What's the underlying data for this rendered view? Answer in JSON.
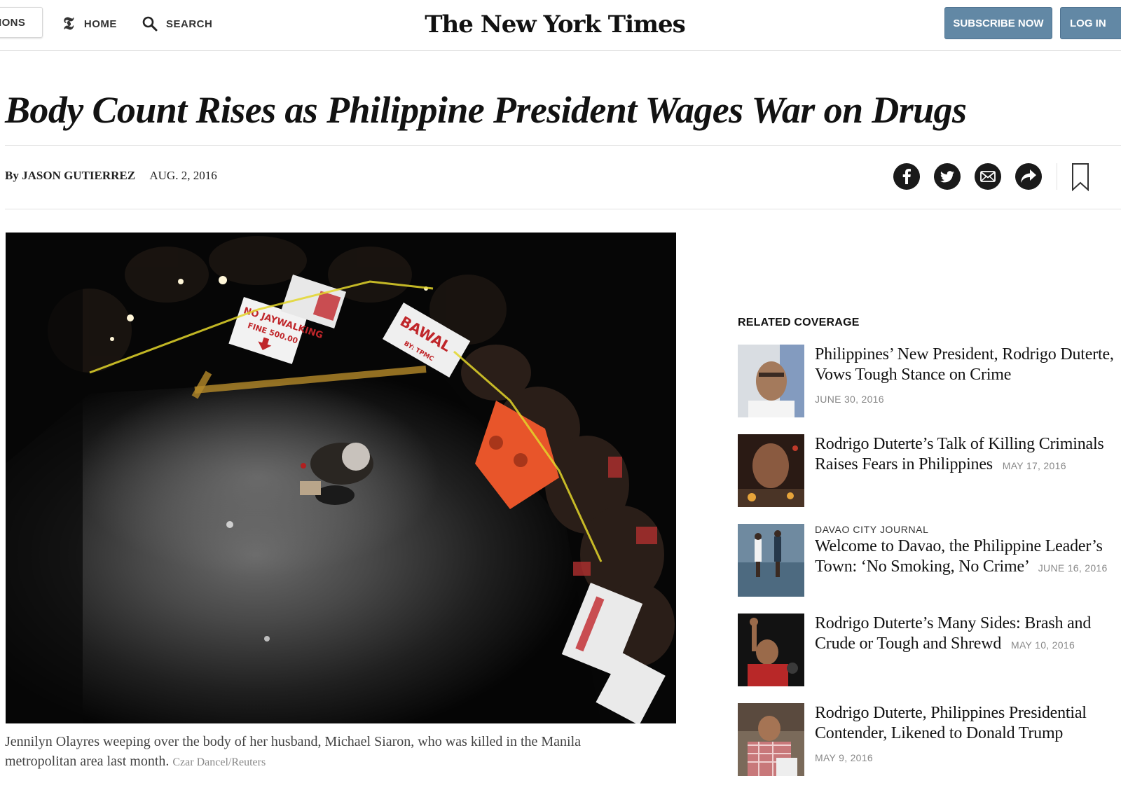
{
  "header": {
    "sections_label": "IONS",
    "home_label": "HOME",
    "search_label": "SEARCH",
    "masthead": "The New York Times",
    "subscribe_label": "SUBSCRIBE NOW",
    "login_label": "LOG IN"
  },
  "article": {
    "headline": "Body Count Rises as Philippine President Wages War on Drugs",
    "byline": "By JASON GUTIERREZ",
    "date": "AUG. 2, 2016",
    "share_icons": [
      "facebook-icon",
      "twitter-icon",
      "email-icon",
      "share-icon",
      "bookmark-icon"
    ],
    "photo": {
      "sign_text": "NO JAYWALKING",
      "sign_text_2": "FINE 500.00",
      "banner_text": "BAWAL",
      "banner_text_2": "BY: TPMC"
    },
    "caption": "Jennilyn Olayres weeping over the body of her husband, Michael Siaron, who was killed in the Manila metropolitan area last month.",
    "credit": "Czar Dancel/Reuters"
  },
  "related": {
    "heading": "RELATED COVERAGE",
    "items": [
      {
        "kicker": "",
        "title": "Philippines’ New President, Rodrigo Duterte, Vows Tough Stance on Crime",
        "date": "JUNE 30, 2016"
      },
      {
        "kicker": "",
        "title": "Rodrigo Duterte’s Talk of Killing Criminals Raises Fears in Philippines",
        "date": "MAY 17, 2016"
      },
      {
        "kicker": "DAVAO CITY JOURNAL",
        "title": "Welcome to Davao, the Philippine Leader’s Town: ‘No Smoking, No Crime’",
        "date": "JUNE 16, 2016"
      },
      {
        "kicker": "",
        "title": "Rodrigo Duterte’s Many Sides: Brash and Crude or Tough and Shrewd",
        "date": "MAY 10, 2016"
      },
      {
        "kicker": "",
        "title": "Rodrigo Duterte, Philippines Presidential Contender, Likened to Donald Trump",
        "date": "MAY 9, 2016"
      }
    ]
  },
  "colors": {
    "subscribe": "#6288a5",
    "icon_bg": "#1a1a1a",
    "rule": "#e2e2e2",
    "barrier": "#e8552a"
  }
}
